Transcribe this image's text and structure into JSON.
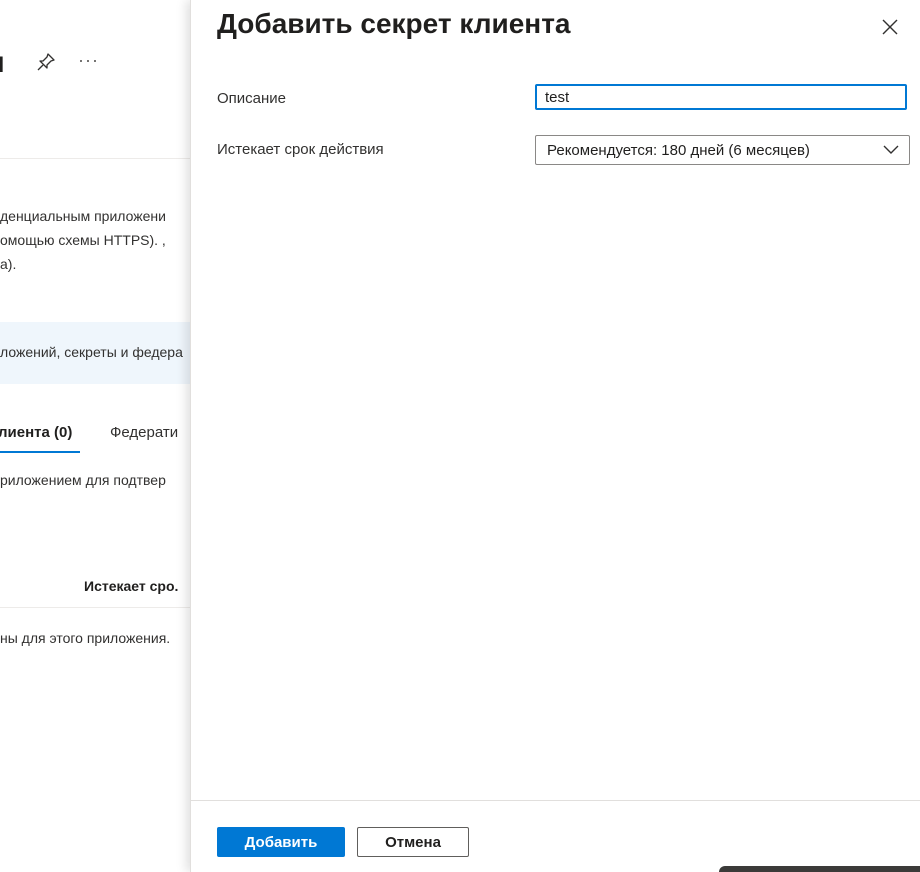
{
  "background": {
    "title_fragment": "I",
    "more_label": "···",
    "description_lines": [
      "денциальным приложени",
      "омощью схемы HTTPS). ,",
      "а)."
    ],
    "info_text": "ложений, секреты и федера",
    "tabs": [
      {
        "label": "лиента (0)"
      },
      {
        "label": "Федерати"
      }
    ],
    "tab_description": "риложением для подтвер",
    "table": {
      "column_header": "Истекает сро.",
      "empty_text": "ны для этого приложения."
    }
  },
  "panel": {
    "title": "Добавить секрет клиента",
    "description": {
      "label": "Описание",
      "value": "test"
    },
    "expires": {
      "label": "Истекает срок действия",
      "selected": "Рекомендуется: 180 дней (6 месяцев)"
    },
    "buttons": {
      "add": "Добавить",
      "cancel": "Отмена"
    }
  },
  "colors": {
    "accent": "#0078d4",
    "info_background": "#eff6fc"
  }
}
